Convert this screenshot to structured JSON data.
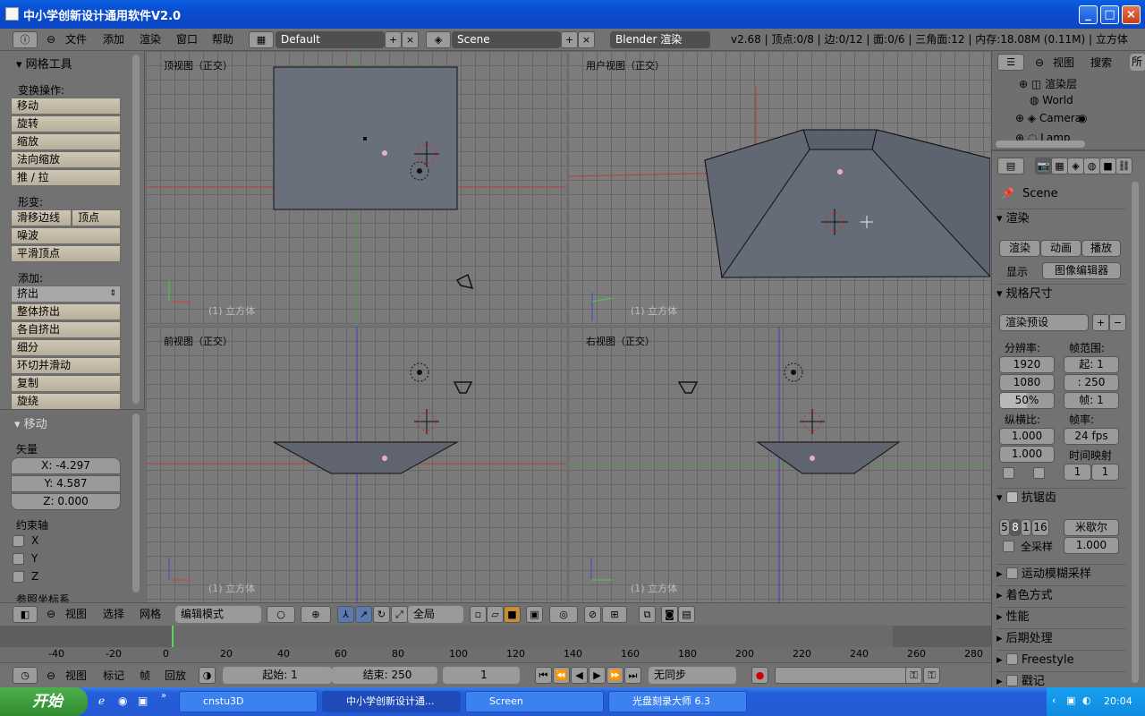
{
  "window": {
    "title": "中小学创新设计通用软件V2.0",
    "min": "_",
    "max": "□",
    "close": "×"
  },
  "topbar": {
    "menus": [
      "文件",
      "添加",
      "渲染",
      "窗口",
      "帮助"
    ],
    "layout": "Default",
    "scene": "Scene",
    "engine": "Blender 渲染",
    "stats": "v2.68 | 顶点:0/8 | 边:0/12 | 面:0/6 | 三角面:12 | 内存:18.08M (0.11M) | 立方体"
  },
  "left_panel": {
    "header": "网格工具",
    "transform_label": "变换操作:",
    "transform": [
      "移动",
      "旋转",
      "缩放",
      "法向缩放",
      "推 / 拉"
    ],
    "deform_label": "形变:",
    "slide_edge": "滑移边线",
    "slide_vertex": "顶点",
    "deform": [
      "噪波",
      "平滑顶点"
    ],
    "add_label": "添加:",
    "extrude": "挤出",
    "add": [
      "整体挤出",
      "各自挤出",
      "细分",
      "环切并滑动",
      "复制",
      "旋绕"
    ],
    "op_header": "移动",
    "vector_label": "矢量",
    "vector": [
      "X: -4.297",
      "Y: 4.587",
      "Z: 0.000"
    ],
    "constraint_label": "约束轴",
    "axes": [
      "X",
      "Y",
      "Z"
    ],
    "orient_label": "参照坐标系"
  },
  "viewports": {
    "top": {
      "label": "顶视图（正交）",
      "obj": "(1) 立方体"
    },
    "user": {
      "label": "用户视图（正交）",
      "obj": "(1) 立方体"
    },
    "front": {
      "label": "前视图（正交）",
      "obj": "(1) 立方体"
    },
    "right": {
      "label": "右视图（正交）",
      "obj": "(1) 立方体"
    }
  },
  "view_header": {
    "items": [
      "视图",
      "选择",
      "网格"
    ],
    "mode": "编辑模式",
    "global": "全局"
  },
  "timeline": {
    "ticks": [
      "-40",
      "-20",
      "0",
      "20",
      "40",
      "60",
      "80",
      "100",
      "120",
      "140",
      "160",
      "180",
      "200",
      "220",
      "240",
      "260",
      "280"
    ],
    "items": [
      "视图",
      "标记",
      "帧",
      "回放"
    ],
    "start": "起始: 1",
    "end": "结束: 250",
    "current": "1",
    "sync": "无同步"
  },
  "outliner": {
    "items": [
      "视图",
      "搜索"
    ],
    "menu_stub": "所",
    "rows": [
      "渲染层",
      "World",
      "Camera",
      "Lamp"
    ]
  },
  "properties": {
    "scene": "Scene",
    "render_header": "渲染",
    "render_btn": "渲染",
    "anim_btn": "动画",
    "play_btn": "播放",
    "display_label": "显示",
    "display_value": "图像编辑器",
    "dims_header": "规格尺寸",
    "preset": "渲染预设",
    "res_label": "分辨率:",
    "res_x": "1920",
    "res_y": "1080",
    "res_pct": "50%",
    "frame_label": "帧范围:",
    "frame_start": "起: 1",
    "frame_end": ": 250",
    "frame_step": "帧: 1",
    "aspect_label": "纵横比:",
    "aspect_x": "1.000",
    "aspect_y": "1.000",
    "fps_label": "帧率:",
    "fps": "24 fps",
    "remap_label": "时间映射",
    "remap_old": "1",
    "remap_new": "1",
    "aa_header": "抗锯齿",
    "aa_samples": [
      "5",
      "8",
      "1",
      "16"
    ],
    "aa_filter": "米歇尔",
    "full_sample": "全采样",
    "filter_size": "1.000",
    "sections": [
      "运动模糊采样",
      "着色方式",
      "性能",
      "后期处理",
      "Freestyle",
      "戳记"
    ]
  },
  "taskbar": {
    "start": "开始",
    "tasks": [
      "cnstu3D",
      "中小学创新设计通...",
      "Screen",
      "光盘刻录大师 6.3"
    ],
    "clock": "20:04"
  }
}
